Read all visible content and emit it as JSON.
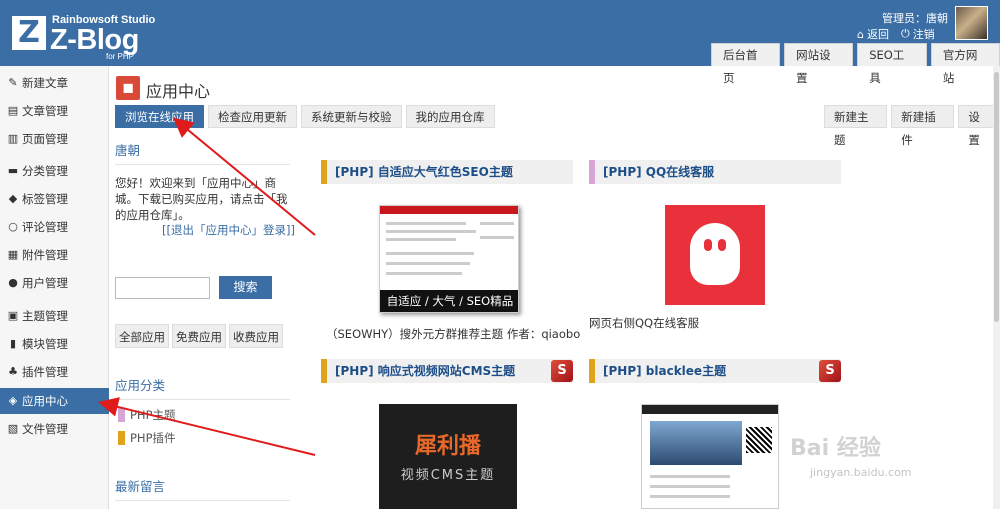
{
  "header": {
    "brand_studio": "Rainbowsoft Studio",
    "brand_title": "Z-Blog",
    "brand_sub": "for PHP",
    "logo_letter": "Z",
    "admin_label": "管理员：唐朝",
    "back_label": "返回",
    "logout_label": "注销",
    "tabs": [
      "后台首页",
      "网站设置",
      "SEO工具",
      "官方网站"
    ]
  },
  "sidebar": {
    "items": [
      {
        "label": "新建文章",
        "icon": "new-article-icon"
      },
      {
        "label": "文章管理",
        "icon": "article-manage-icon"
      },
      {
        "label": "页面管理",
        "icon": "page-manage-icon"
      },
      {
        "label": "分类管理",
        "icon": "folder-icon"
      },
      {
        "label": "标签管理",
        "icon": "tag-icon"
      },
      {
        "label": "评论管理",
        "icon": "comment-icon"
      },
      {
        "label": "附件管理",
        "icon": "attachment-icon"
      },
      {
        "label": "用户管理",
        "icon": "user-icon"
      },
      {
        "label": "主题管理",
        "icon": "theme-icon"
      },
      {
        "label": "模块管理",
        "icon": "module-icon"
      },
      {
        "label": "插件管理",
        "icon": "plugin-icon"
      },
      {
        "label": "应用中心",
        "icon": "app-center-icon",
        "active": true
      },
      {
        "label": "文件管理",
        "icon": "file-icon"
      }
    ]
  },
  "page": {
    "title": "应用中心",
    "subtabs": [
      "浏览在线应用",
      "检查应用更新",
      "系统更新与校验",
      "我的应用仓库"
    ],
    "right_tabs": [
      "新建主题",
      "新建插件",
      "设置"
    ]
  },
  "left": {
    "user_title": "唐朝",
    "welcome": "您好！欢迎来到「应用中心」商城。下载已购买应用，请点击「我的应用仓库」。",
    "logout_link": "[[退出「应用中心」登录]]",
    "search_button": "搜索",
    "filters": [
      "全部应用",
      "免费应用",
      "收费应用"
    ],
    "category_title": "应用分类",
    "categories": [
      {
        "label": "PHP主题",
        "color": "#d8a6d4"
      },
      {
        "label": "PHP插件",
        "color": "#e0a31c"
      }
    ],
    "latest_title": "最新留言"
  },
  "apps": [
    {
      "title": "[PHP] 自适应大气红色SEO主题",
      "caption": "（SEOWHY）搜外元方群推荐主题 作者：qiaobo",
      "thumb_text": "自适应 / 大气 / SEO精品"
    },
    {
      "title": "[PHP] QQ在线客服",
      "caption": "网页右侧QQ在线客服"
    },
    {
      "title": "[PHP] 响应式视频网站CMS主题",
      "badge": "S",
      "thumb_title": "犀利播",
      "thumb_sub": "视频CMS主题"
    },
    {
      "title": "[PHP] blacklee主题",
      "badge": "S"
    }
  ],
  "watermark": {
    "main": "Bai 经验",
    "sub": "jingyan.baidu.com"
  },
  "colors": {
    "accent": "#3a6ea5",
    "orange_bar": "#e0a31c",
    "pink_bar": "#d8a6d4",
    "qq_red": "#e8313b"
  }
}
